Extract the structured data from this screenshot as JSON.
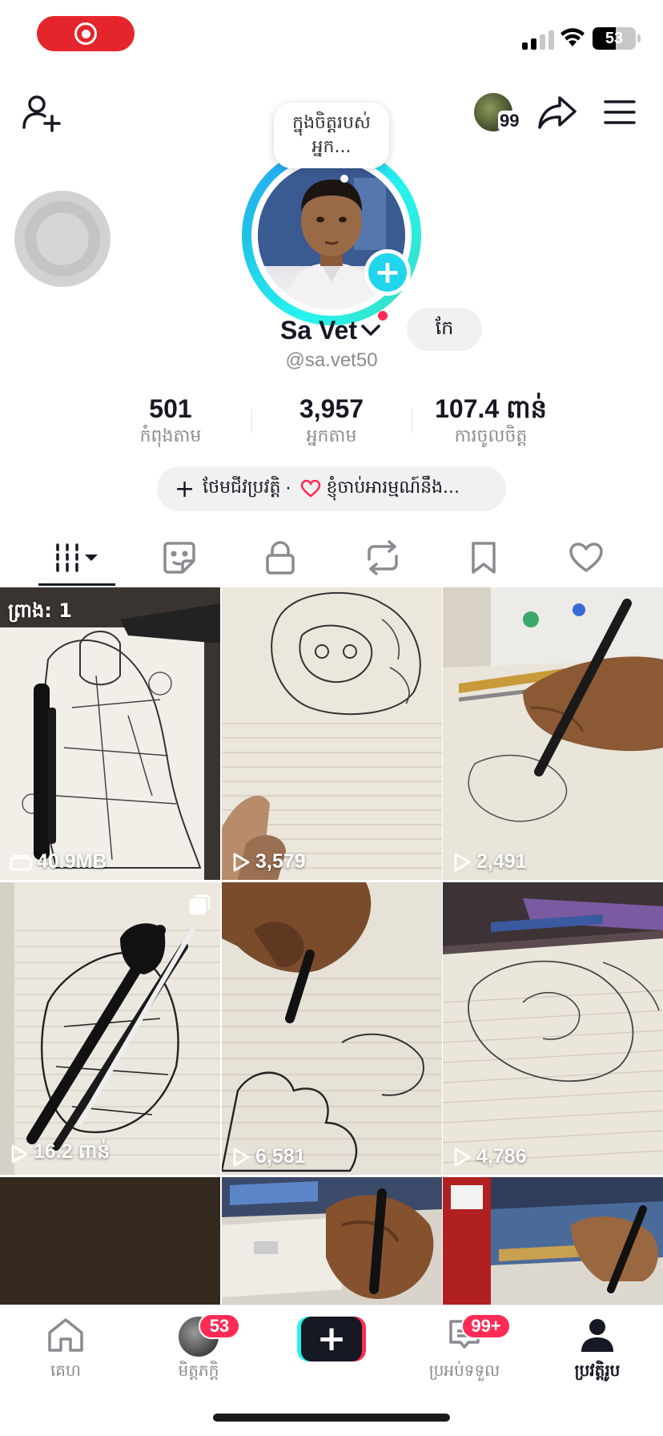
{
  "status_bar": {
    "battery_level": "53",
    "battery_fraction": 0.53
  },
  "header": {
    "mini_avatar_count": "99"
  },
  "profile": {
    "thought_bubble": "ក្នុងចិត្តរបស់អ្នក...",
    "name": "Sa Vet",
    "edit_label": "កែ",
    "handle": "@sa.vet50"
  },
  "stats": [
    {
      "value": "501",
      "label": "កំពុងតាម"
    },
    {
      "value": "3,957",
      "label": "អ្នកតាម"
    },
    {
      "value": "107.4 ពាន់",
      "label": "ការចូលចិត្ត"
    }
  ],
  "bio": {
    "add_bio": "ថែមជីវប្រវត្តិ",
    "separator": "·",
    "text": "ខ្ញុំចាប់អារម្មណ៍នឹង..."
  },
  "tabs": [
    {
      "name": "videos",
      "icon": "grid-icon"
    },
    {
      "name": "reposts",
      "icon": "sticker-icon"
    },
    {
      "name": "private",
      "icon": "lock-icon"
    },
    {
      "name": "repost",
      "icon": "repost-icon"
    },
    {
      "name": "saved",
      "icon": "bookmark-icon"
    },
    {
      "name": "liked",
      "icon": "heart-icon"
    }
  ],
  "videos": [
    {
      "label": "40.9MB",
      "kind": "draft-size",
      "draft_label": "ព្រាង: 1"
    },
    {
      "label": "3,579",
      "kind": "views"
    },
    {
      "label": "2,491",
      "kind": "views"
    },
    {
      "label": "16.2 ពាន់",
      "kind": "views",
      "multi": true
    },
    {
      "label": "6,581",
      "kind": "views"
    },
    {
      "label": "4,786",
      "kind": "views"
    },
    {
      "label": "",
      "kind": "none"
    },
    {
      "label": "",
      "kind": "none"
    },
    {
      "label": "",
      "kind": "none"
    }
  ],
  "bottom_nav": {
    "home": "គេហ",
    "friends": "មិត្តភក្តិ",
    "friends_badge": "53",
    "inbox": "ប្រអប់ទទួល",
    "inbox_badge": "99+",
    "profile": "ប្រវត្តិរូប"
  },
  "colors": {
    "accent_red": "#fe2c55",
    "accent_cyan": "#25f4ee",
    "text_primary": "#161823",
    "text_secondary": "#8a8b91"
  }
}
